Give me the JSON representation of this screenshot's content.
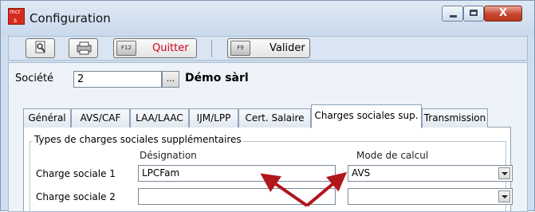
{
  "window": {
    "title": "Configuration",
    "icon_label_top": "mcr",
    "icon_label_bottom": "s",
    "controls": {
      "minimize": "minimize-icon",
      "maximize": "maximize-icon",
      "close": "X"
    }
  },
  "toolbar": {
    "preview_icon": "print-preview-icon",
    "print_icon": "printer-icon",
    "quit_key": "F12",
    "quit_label": "Quitter",
    "validate_key": "F9",
    "validate_label": "Valider"
  },
  "company": {
    "label": "Société",
    "value": "2",
    "lookup_label": "...",
    "name": "Démo sàrl"
  },
  "tabs": [
    {
      "label": "Général",
      "active": false
    },
    {
      "label": "AVS/CAF",
      "active": false
    },
    {
      "label": "LAA/LAAC",
      "active": false
    },
    {
      "label": "IJM/LPP",
      "active": false
    },
    {
      "label": "Cert. Salaire",
      "active": false
    },
    {
      "label": "Charges sociales sup.",
      "active": true
    },
    {
      "label": "Transmission",
      "active": false
    }
  ],
  "group": {
    "title": "Types de charges sociales supplémentaires",
    "col_designation": "Désignation",
    "col_mode": "Mode de calcul",
    "rows": [
      {
        "label": "Charge sociale 1",
        "designation": "LPCFam",
        "mode": "AVS"
      },
      {
        "label": "Charge sociale 2",
        "designation": "",
        "mode": ""
      }
    ]
  },
  "colors": {
    "quit_text": "#d0021b",
    "annotation_arrow": "#b0171d"
  }
}
